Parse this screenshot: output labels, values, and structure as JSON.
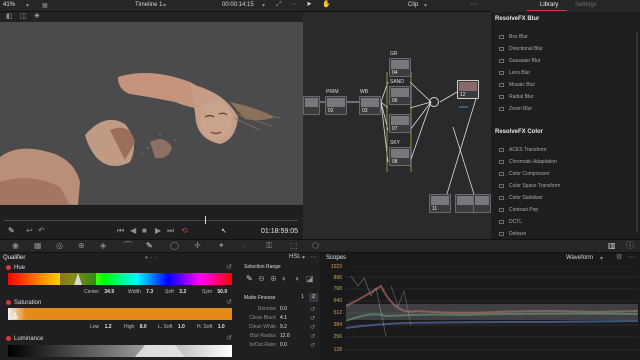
{
  "topbar": {
    "zoom": "41%",
    "timeline": "Timeline 1",
    "timecode": "00:00:14:15",
    "clip_label": "Clip",
    "tab_library": "Library",
    "tab_settings": "Settings"
  },
  "transport": {
    "timecode": "01:18:59:05"
  },
  "nodes": {
    "prim": "PRIM",
    "wb": "WB",
    "gr": "GR",
    "sand": "SAND",
    "sky": "SKY",
    "n02": "02",
    "n03": "03",
    "n04": "04",
    "n06": "06",
    "n07": "07",
    "n08": "08",
    "n12": "12",
    "n11": "11"
  },
  "library": {
    "blur_header": "ResolveFX Blur",
    "blur_items": [
      "Box Blur",
      "Directional Blur",
      "Gaussian Blur",
      "Lens Blur",
      "Mosaic Blur",
      "Radial Blur",
      "Zoom Blur"
    ],
    "color_header": "ResolveFX Color",
    "color_items": [
      "ACES Transform",
      "Chromatic Adaptation",
      "Color Compressor",
      "Color Space Transform",
      "Color Stabilizer",
      "Contrast Pop",
      "DCTL",
      "Dehaze"
    ]
  },
  "qualifier": {
    "title": "Qualifier",
    "mode": "HSL",
    "hue_label": "Hue",
    "hue": {
      "center_label": "Center",
      "center": "34.9",
      "width_label": "Width",
      "width": "7.3",
      "soft_label": "Soft",
      "soft": "3.2",
      "sym_label": "Sym",
      "sym": "50.0"
    },
    "sat_label": "Saturation",
    "sat": {
      "low_label": "Low",
      "low": "1.2",
      "high_label": "High",
      "high": "8.0",
      "lsoft_label": "L. Soft",
      "lsoft": "1.0",
      "hsoft_label": "H. Soft",
      "hsoft": "1.0"
    },
    "lum_label": "Luminance",
    "selection_range": "Selection Range",
    "matte_finesse": "Matte Finesse",
    "matte_pages": [
      "1",
      "2"
    ],
    "matte": [
      {
        "label": "Denoise",
        "value": "0.0"
      },
      {
        "label": "Clean Black",
        "value": "4.1"
      },
      {
        "label": "Clean White",
        "value": "9.2"
      },
      {
        "label": "Blur Radius",
        "value": "12.6"
      },
      {
        "label": "In/Out Ratio",
        "value": "0.0"
      }
    ]
  },
  "scopes": {
    "title": "Scopes",
    "mode": "Waveform",
    "scale": [
      "1023",
      "896",
      "768",
      "640",
      "512",
      "384",
      "256",
      "128"
    ]
  },
  "colors": {
    "accent_red": "#d33b3b",
    "orange_bar": "#e38a1b"
  }
}
